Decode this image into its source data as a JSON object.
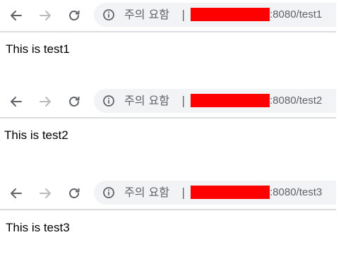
{
  "windows": [
    {
      "security_label": "주의 요함",
      "separator": "|",
      "url_tail": ":8080/test1",
      "body_text": "This is test1"
    },
    {
      "security_label": "주의 요함",
      "separator": "|",
      "url_tail": ":8080/test2",
      "body_text": "This is test2"
    },
    {
      "security_label": "주의 요함",
      "separator": "|",
      "url_tail": ":8080/test3",
      "body_text": "This is test3"
    }
  ],
  "icons": {
    "back": "back-arrow-icon",
    "forward": "forward-arrow-icon",
    "reload": "reload-icon",
    "info": "info-icon"
  },
  "colors": {
    "redaction": "#ff0000",
    "omnibox_bg": "#f1f3f4",
    "icon_active": "#5f6368",
    "icon_disabled": "#b8bbbe"
  }
}
